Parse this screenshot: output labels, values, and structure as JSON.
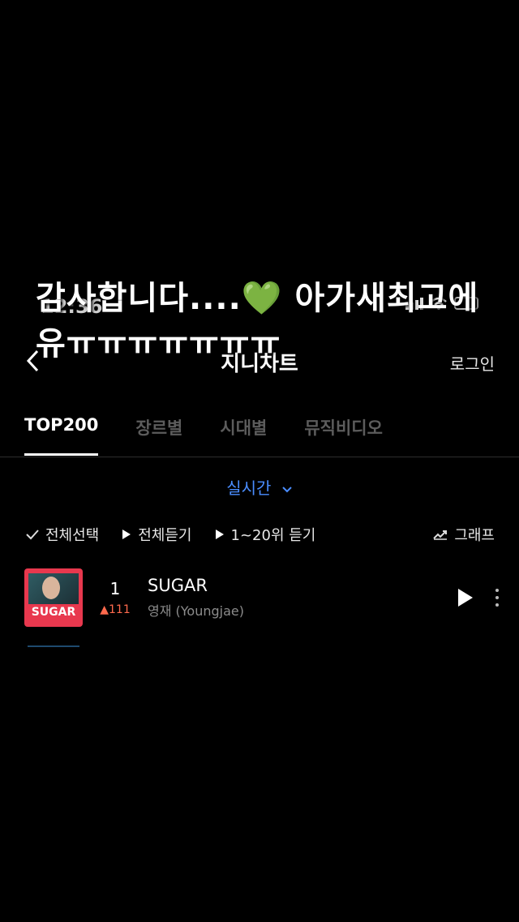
{
  "status": {
    "time": "12:36"
  },
  "header": {
    "title": "지니차트",
    "login": "로그인"
  },
  "overlay": {
    "caption": "감사합니다....💚 아가새최고에유ㅠㅠㅠㅠㅠㅠㅠ"
  },
  "tabs": [
    {
      "label": "TOP200",
      "active": true
    },
    {
      "label": "장르별",
      "active": false
    },
    {
      "label": "시대별",
      "active": false
    },
    {
      "label": "뮤직비디오",
      "active": false
    }
  ],
  "chart_mode": {
    "label": "실시간"
  },
  "toolbar": {
    "select_all": "전체선택",
    "play_all": "전체듣기",
    "play_range": "1~20위 듣기",
    "graph": "그래프"
  },
  "songs": [
    {
      "rank": "1",
      "change": "▲111",
      "title": "SUGAR",
      "artist": "영재 (Youngjae)",
      "album_text": "SUGAR"
    }
  ],
  "colors": {
    "accent": "#4a8dff",
    "rank_up": "#ff6a4d",
    "album": "#e8384e"
  }
}
